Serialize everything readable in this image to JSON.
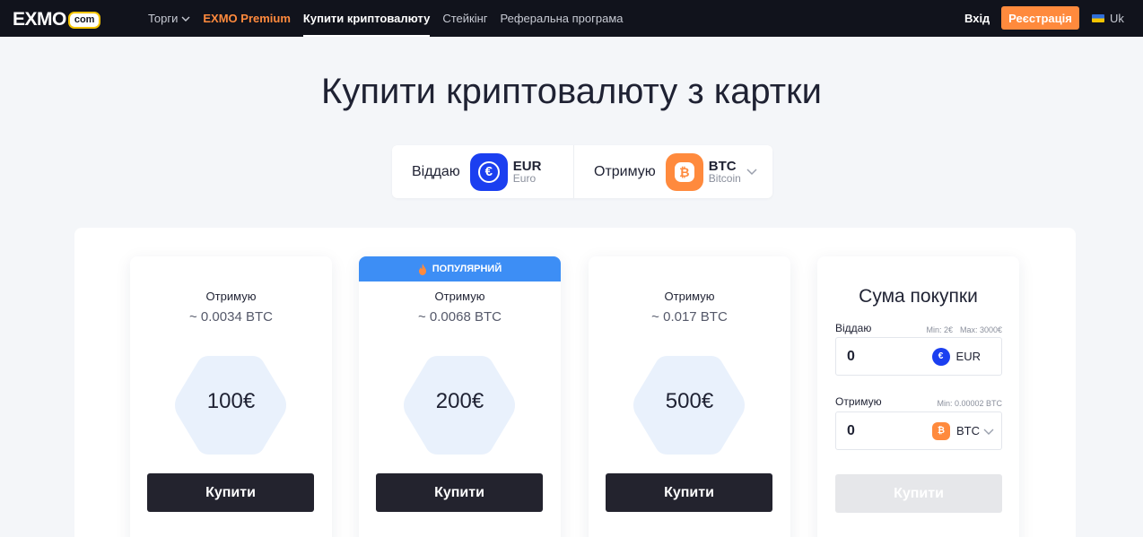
{
  "header": {
    "logo_text": "EXMO",
    "logo_badge": "com",
    "nav": [
      {
        "label": "Торги"
      },
      {
        "label": "EXMO Premium"
      },
      {
        "label": "Купити криптовалюту"
      },
      {
        "label": "Стейкінг"
      },
      {
        "label": "Реферальна програма"
      }
    ],
    "login_label": "Вхід",
    "register_label": "Реєстрація",
    "lang_label": "Uk"
  },
  "page_title": "Купити криптовалюту з картки",
  "selector": {
    "give_label": "Віддаю",
    "give_code": "EUR",
    "give_name": "Euro",
    "get_label": "Отримую",
    "get_code": "BTC",
    "get_name": "Bitcoin"
  },
  "cards": [
    {
      "get_label": "Отримую",
      "amount": "~ 0.0034 BTC",
      "price": "100€",
      "buy_label": "Купити"
    },
    {
      "badge": "ПОПУЛЯРНИЙ",
      "get_label": "Отримую",
      "amount": "~ 0.0068 BTC",
      "price": "200€",
      "buy_label": "Купити"
    },
    {
      "get_label": "Отримую",
      "amount": "~ 0.017 BTC",
      "price": "500€",
      "buy_label": "Купити"
    }
  ],
  "sum": {
    "title": "Сума покупки",
    "give_label": "Віддаю",
    "give_min": "Min: 2€",
    "give_max": "Max: 3000€",
    "give_value": "0",
    "give_currency": "EUR",
    "get_label": "Отримую",
    "get_min": "Min: 0.00002 BTC",
    "get_value": "0",
    "get_currency": "BTC",
    "buy_label": "Купити"
  },
  "colors": {
    "header_bg": "#11131c",
    "accent_orange": "#ff8a3d",
    "eur_blue": "#1b3ff0",
    "popular_blue": "#3d8ef5",
    "buy_dark": "#23232e"
  }
}
